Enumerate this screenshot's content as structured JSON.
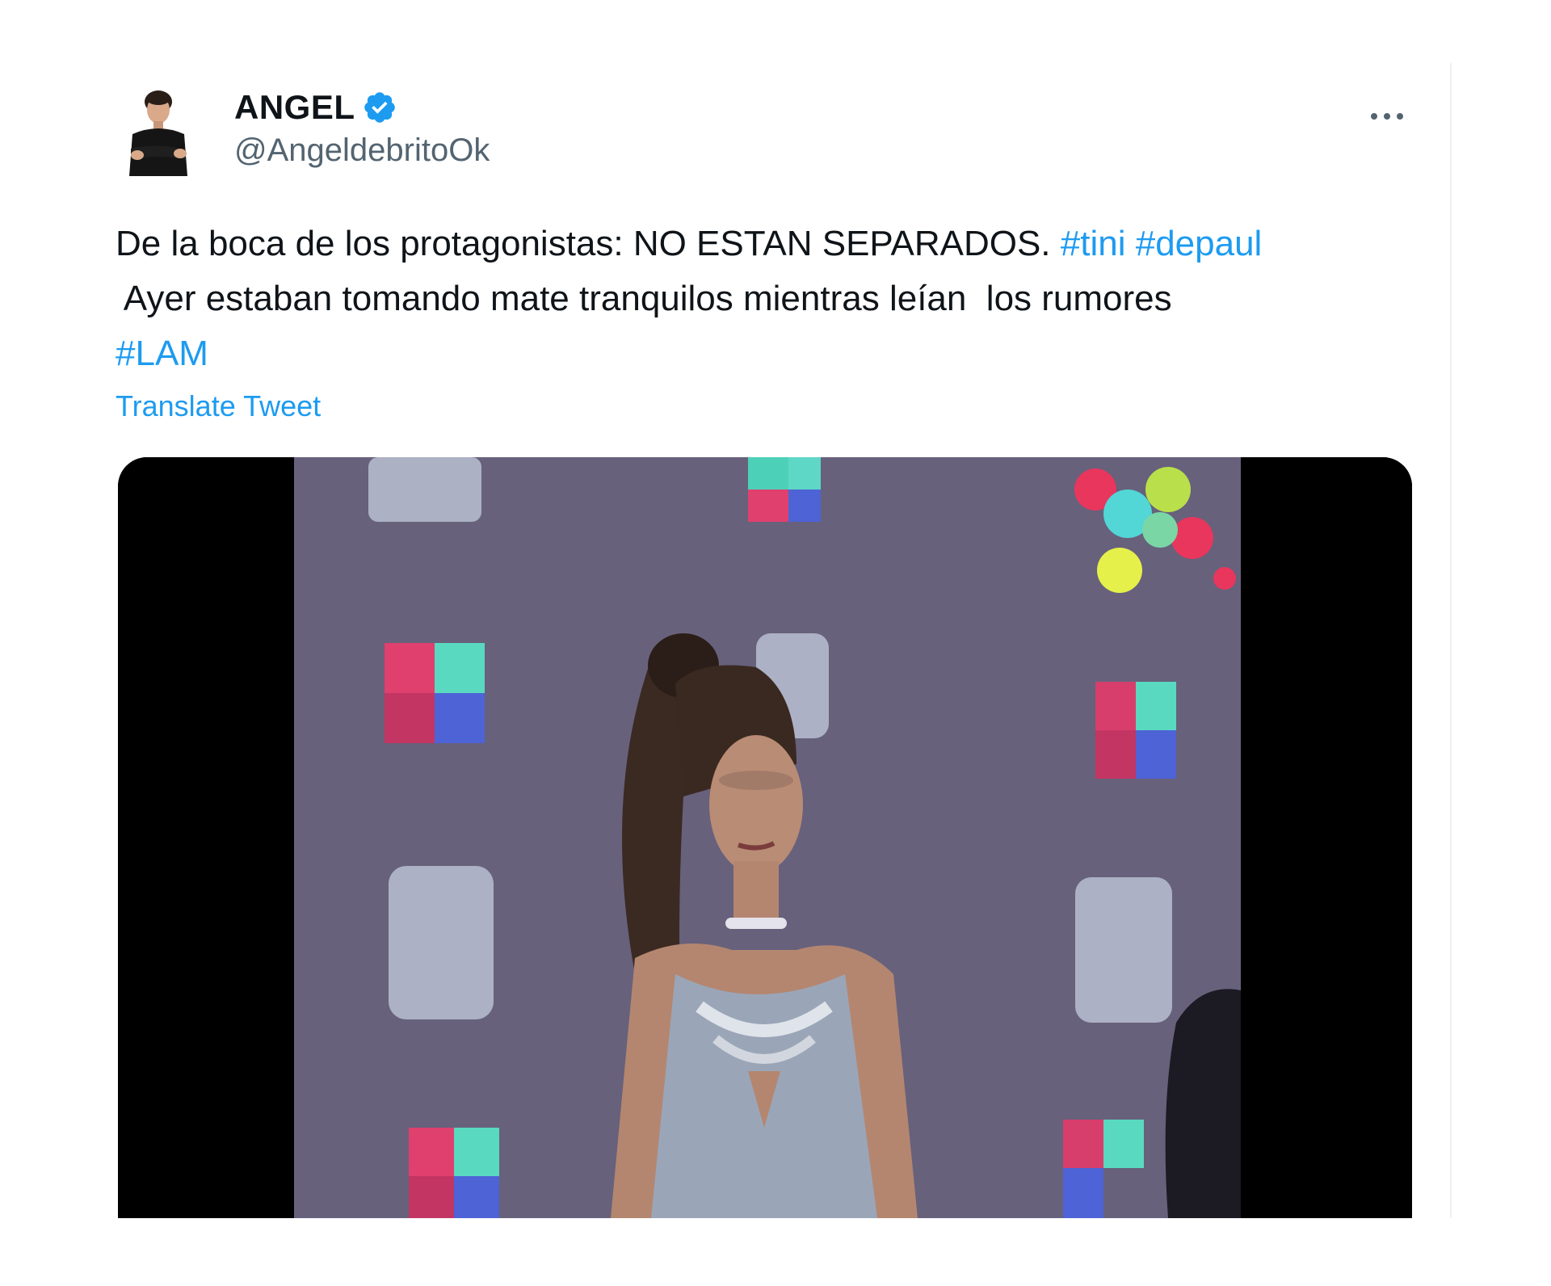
{
  "tweet": {
    "author": {
      "display_name": "ANGEL",
      "handle": "@AngeldebritoOk",
      "verified_icon": "verified-badge-icon",
      "avatar_icon": "avatar-photo"
    },
    "more_icon": "more-horizontal-icon",
    "text": {
      "line1_prefix": "De la boca de los protagonistas: NO ESTAN SEPARADOS. ",
      "line1_tag1": "#tini",
      "line1_tag2": "#depaul",
      "line2": " Ayer estaban tomando mate tranquilos mientras leían  los rumores",
      "line3_tag": "#LAM"
    },
    "translate_label": "Translate Tweet",
    "media": {
      "type": "video-frame",
      "description_icon": "media-photo"
    }
  },
  "colors": {
    "text": "#0f1419",
    "secondary": "#536471",
    "link": "#1d9bf0",
    "backdrop": "#6b6480"
  }
}
